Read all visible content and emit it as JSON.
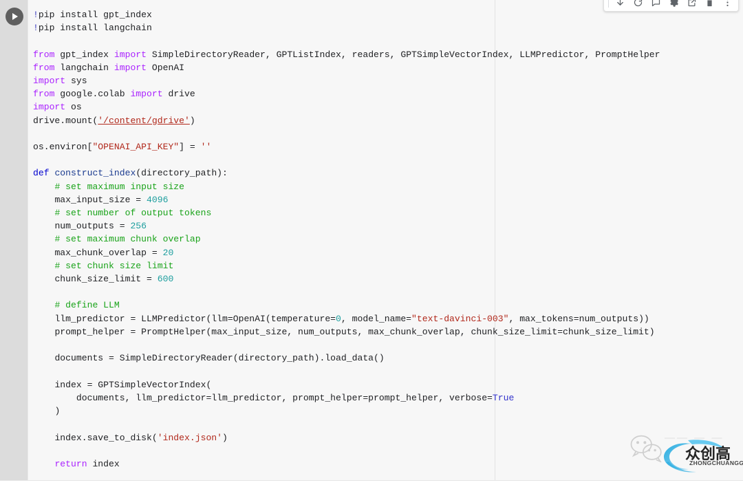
{
  "window": {
    "app": "Google Colab notebook cell",
    "kind": "code-cell"
  },
  "toolbar": {
    "buttons": [
      {
        "name": "move-cell-down-button",
        "label": "Move cell down",
        "icon": "arrow-down-icon"
      },
      {
        "name": "refresh-button",
        "label": "Refresh",
        "icon": "refresh-icon"
      },
      {
        "name": "comment-button",
        "label": "Comment",
        "icon": "comment-icon"
      },
      {
        "name": "edit-settings-button",
        "label": "Editor settings",
        "icon": "gear-icon"
      },
      {
        "name": "mirror-cell-button",
        "label": "Mirror cell in tab",
        "icon": "open-in-new-icon"
      },
      {
        "name": "delete-cell-button",
        "label": "Delete cell",
        "icon": "trash-icon"
      },
      {
        "name": "more-options-button",
        "label": "More cell actions",
        "icon": "more-vert-icon"
      }
    ]
  },
  "cell": {
    "run_button_label": "Run cell",
    "run_button_icon": "play-icon",
    "language": "python"
  },
  "colors": {
    "gutter": "#dcdcdc",
    "editor_background": "#f7f7f7",
    "keyword": "#aa22ff",
    "def_keyword": "#0000cf",
    "function_name": "#1a3a8f",
    "comment": "#19a319",
    "number": "#1d9e9e",
    "string": "#b1281b",
    "boolean": "#3333cc",
    "plain_text": "#202124",
    "run_button": "#5f5f5f",
    "ruler_guide": "#e3e3e3"
  },
  "code": {
    "lines": [
      "!pip install gpt_index",
      "!pip install langchain",
      "",
      "from gpt_index import SimpleDirectoryReader, GPTListIndex, readers, GPTSimpleVectorIndex, LLMPredictor, PromptHelper",
      "from langchain import OpenAI",
      "import sys",
      "from google.colab import drive",
      "import os",
      "drive.mount('/content/gdrive')",
      "",
      "os.environ[\"OPENAI_API_KEY\"] = ''",
      "",
      "def construct_index(directory_path):",
      "    # set maximum input size",
      "    max_input_size = 4096",
      "    # set number of output tokens",
      "    num_outputs = 256",
      "    # set maximum chunk overlap",
      "    max_chunk_overlap = 20",
      "    # set chunk size limit",
      "    chunk_size_limit = 600",
      "",
      "    # define LLM",
      "    llm_predictor = LLMPredictor(llm=OpenAI(temperature=0, model_name=\"text-davinci-003\", max_tokens=num_outputs))",
      "    prompt_helper = PromptHelper(max_input_size, num_outputs, max_chunk_overlap, chunk_size_limit=chunk_size_limit)",
      "",
      "    documents = SimpleDirectoryReader(directory_path).load_data()",
      "",
      "    index = GPTSimpleVectorIndex(",
      "        documents, llm_predictor=llm_predictor, prompt_helper=prompt_helper, verbose=True",
      "    )",
      "",
      "    index.save_to_disk('index.json')",
      "",
      "    return index"
    ],
    "values": {
      "max_input_size": "4096",
      "num_outputs": "256",
      "max_chunk_overlap": "20",
      "chunk_size_limit": "600",
      "temperature": "0",
      "model_name": "text-davinci-003",
      "verbose": "True",
      "drive_mount_path": "/content/gdrive",
      "env_key": "OPENAI_API_KEY",
      "env_value": "''",
      "index_file": "index.json",
      "function_name": "construct_index",
      "function_arg": "directory_path",
      "pip_packages": [
        "gpt_index",
        "langchain"
      ]
    }
  },
  "watermark": {
    "wechat_icon": "wechat-icon",
    "logo_cn": "众创高",
    "logo_en": "ZHONGCHUANGGAO",
    "ghost_text": "—— — —"
  }
}
